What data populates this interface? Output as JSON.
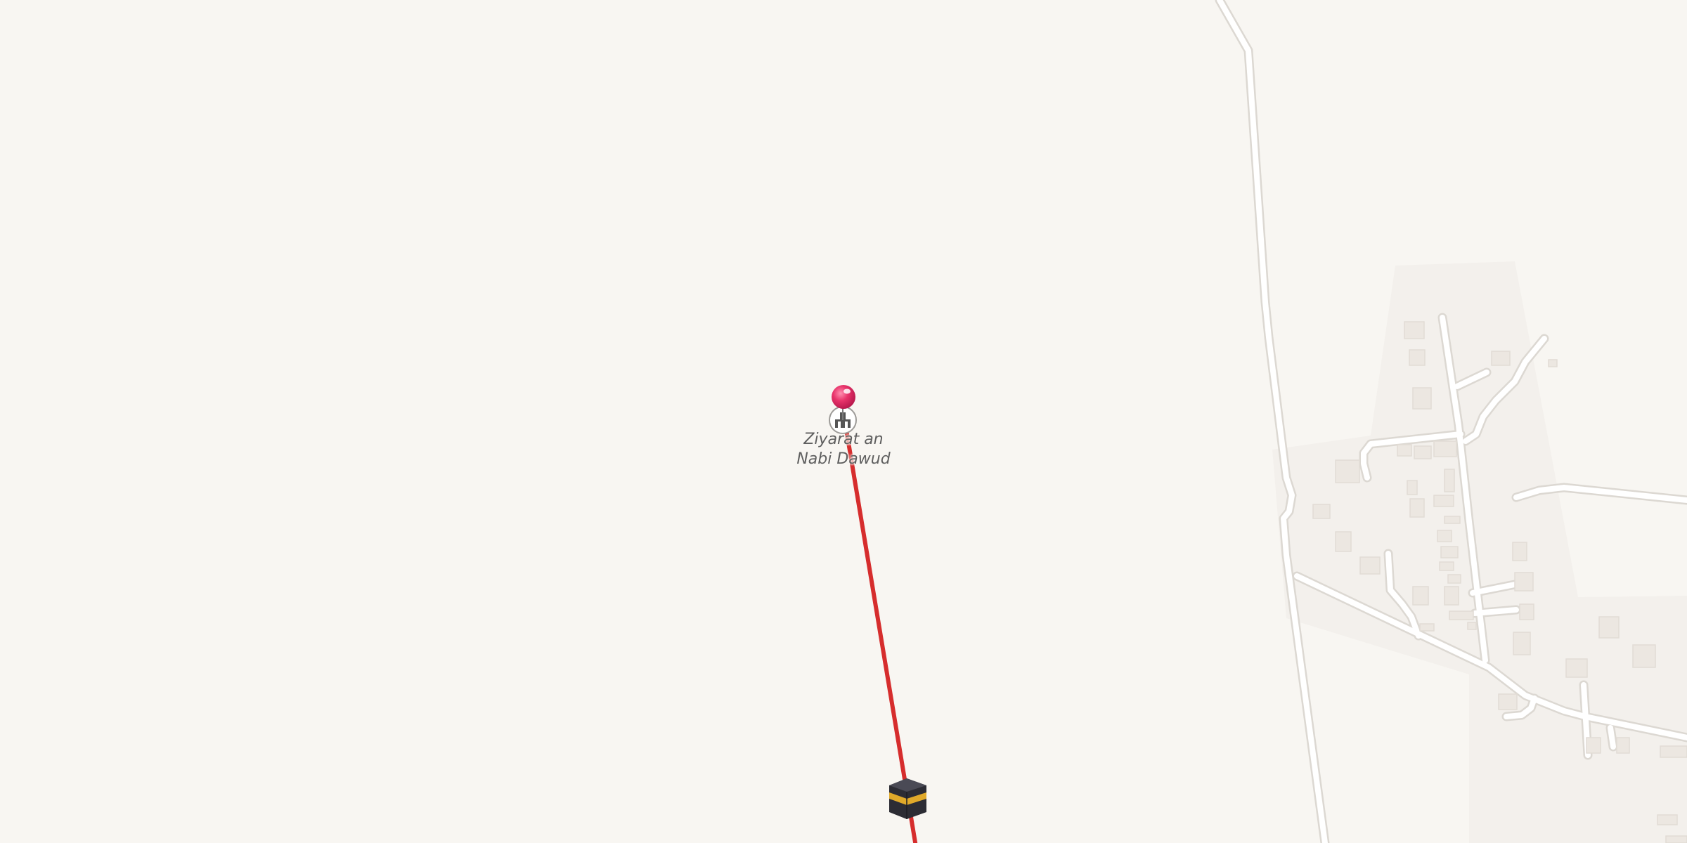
{
  "map": {
    "place_label": {
      "line1": "Ziyarat an",
      "line2": "Nabi Dawud"
    },
    "icons": {
      "pin": "location-pin-icon",
      "place": "mosque-icon",
      "destination": "kaaba-icon"
    },
    "colors": {
      "background": "#f8f6f2",
      "road": "#ffffff",
      "road_casing": "#dedbd6",
      "settlement_area": "#f3f0ec",
      "building": "#ece7e1",
      "route_line": "#d62d2d",
      "pin": "#e8336a"
    }
  }
}
